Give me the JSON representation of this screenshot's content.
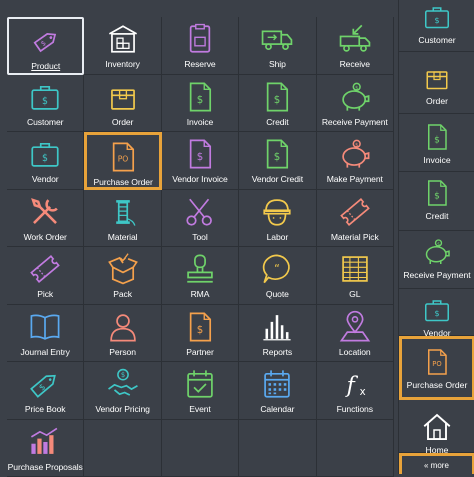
{
  "tiles": [
    {
      "label": "Product",
      "icon": "product-tag-icon"
    },
    {
      "label": "Inventory",
      "icon": "warehouse-icon"
    },
    {
      "label": "Reserve",
      "icon": "reserve-box-icon"
    },
    {
      "label": "Ship",
      "icon": "truck-icon"
    },
    {
      "label": "Receive",
      "icon": "truck-arrow-icon"
    },
    {
      "label": "Customer",
      "icon": "briefcase-dollar-icon"
    },
    {
      "label": "Order",
      "icon": "box-icon"
    },
    {
      "label": "Invoice",
      "icon": "document-dollar-icon"
    },
    {
      "label": "Credit",
      "icon": "document-dollar-icon"
    },
    {
      "label": "Receive Payment",
      "icon": "piggy-bank-icon"
    },
    {
      "label": "Vendor",
      "icon": "briefcase-dollar-icon"
    },
    {
      "label": "Purchase Order",
      "icon": "po-document-icon",
      "text": "PO"
    },
    {
      "label": "Vendor Invoice",
      "icon": "document-dollar-icon"
    },
    {
      "label": "Vendor Credit",
      "icon": "document-dollar-icon"
    },
    {
      "label": "Make Payment",
      "icon": "piggy-bank-icon"
    },
    {
      "label": "Work Order",
      "icon": "tools-icon"
    },
    {
      "label": "Material",
      "icon": "spool-icon"
    },
    {
      "label": "Tool",
      "icon": "scissors-icon"
    },
    {
      "label": "Labor",
      "icon": "hard-hat-icon"
    },
    {
      "label": "Material Pick",
      "icon": "ticket-icon"
    },
    {
      "label": "Pick",
      "icon": "ticket-icon"
    },
    {
      "label": "Pack",
      "icon": "open-box-icon"
    },
    {
      "label": "RMA",
      "icon": "stamp-icon"
    },
    {
      "label": "Quote",
      "icon": "quote-bubble-icon"
    },
    {
      "label": "GL",
      "icon": "ledger-icon"
    },
    {
      "label": "Journal Entry",
      "icon": "open-book-icon"
    },
    {
      "label": "Person",
      "icon": "person-icon"
    },
    {
      "label": "Partner",
      "icon": "document-dollar-icon"
    },
    {
      "label": "Reports",
      "icon": "bar-chart-icon"
    },
    {
      "label": "Location",
      "icon": "map-pin-icon"
    },
    {
      "label": "Price Book",
      "icon": "price-tag-icon"
    },
    {
      "label": "Vendor Pricing",
      "icon": "handshake-dollar-icon"
    },
    {
      "label": "Event",
      "icon": "calendar-check-icon"
    },
    {
      "label": "Calendar",
      "icon": "calendar-icon"
    },
    {
      "label": "Functions",
      "icon": "function-icon"
    },
    {
      "label": "Purchase Proposals",
      "icon": "proposals-chart-icon"
    }
  ],
  "sidebar": [
    {
      "label": "Customer",
      "icon": "briefcase-dollar-icon"
    },
    {
      "label": "Order",
      "icon": "box-icon"
    },
    {
      "label": "Invoice",
      "icon": "document-dollar-icon"
    },
    {
      "label": "Credit",
      "icon": "document-dollar-icon"
    },
    {
      "label": "Receive Payment",
      "icon": "piggy-bank-icon"
    },
    {
      "label": "Vendor",
      "icon": "briefcase-dollar-icon"
    },
    {
      "label": "Purchase Order",
      "icon": "po-document-icon",
      "text": "PO"
    },
    {
      "label": "Home",
      "icon": "home-icon"
    }
  ],
  "more_label": "« more",
  "colors": {
    "background": "#3b4048",
    "highlight": "#e8a33a",
    "purple": "#c17be0",
    "teal": "#3ec7c7",
    "green": "#6fd36a",
    "orange": "#f5a14c",
    "salmon": "#f58a7a",
    "yellow": "#f2c94c",
    "blue": "#5aa9f0",
    "white": "#ffffff"
  }
}
